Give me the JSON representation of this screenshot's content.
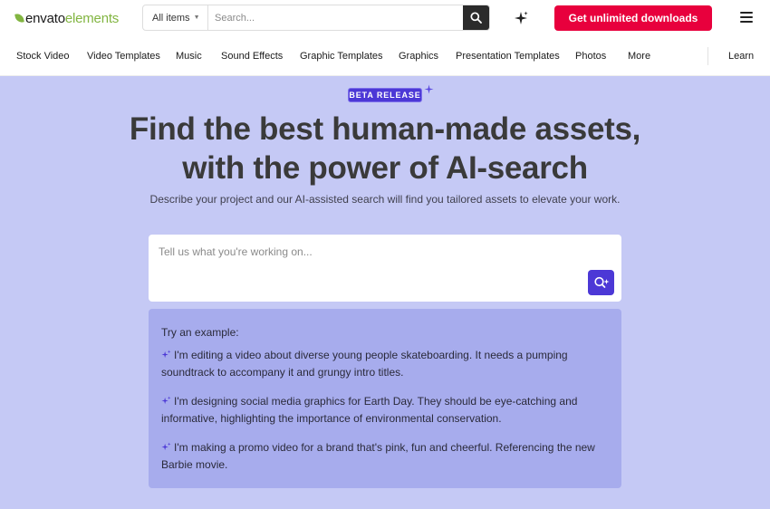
{
  "header": {
    "logo": {
      "word1": "envato",
      "word2": "elements"
    },
    "search": {
      "filter_label": "All items",
      "placeholder": "Search..."
    },
    "cta_label": "Get unlimited downloads"
  },
  "nav": {
    "items": [
      {
        "label": "Stock Video"
      },
      {
        "label": "Video Templates"
      },
      {
        "label": "Music"
      },
      {
        "label": "Sound Effects"
      },
      {
        "label": "Graphic Templates"
      },
      {
        "label": "Graphics"
      },
      {
        "label": "Presentation Templates"
      },
      {
        "label": "Photos"
      },
      {
        "label": "More"
      }
    ],
    "learn_label": "Learn"
  },
  "hero": {
    "badge": "BETA RELEASE",
    "headline_line1": "Find the best human-made assets,",
    "headline_line2": "with the power of AI-search",
    "subheadline": "Describe your project and our AI-assisted search will find you tailored assets to elevate your work.",
    "prompt_placeholder": "Tell us what you're working on...",
    "examples_intro": "Try an example:",
    "examples": [
      {
        "text": "I'm editing a video about diverse young people skateboarding. It needs a pumping soundtrack to accompany it and grungy intro titles."
      },
      {
        "text": "I'm designing social media graphics for Earth Day. They should be eye-catching and informative, highlighting the importance of environmental conservation."
      },
      {
        "text": "I'm making a promo video for a brand that's pink, fun and cheerful. Referencing the new Barbie movie."
      }
    ]
  },
  "colors": {
    "brand_green": "#82b541",
    "cta_red": "#e8003d",
    "accent_purple": "#4c38d6",
    "hero_background": "#c5c9f5",
    "examples_background": "#a7aced"
  },
  "icons": {
    "search": "search-icon",
    "ai_sparkle": "sparkle-icon",
    "menu": "hamburger-menu-icon",
    "ai_search": "ai-search-icon"
  }
}
